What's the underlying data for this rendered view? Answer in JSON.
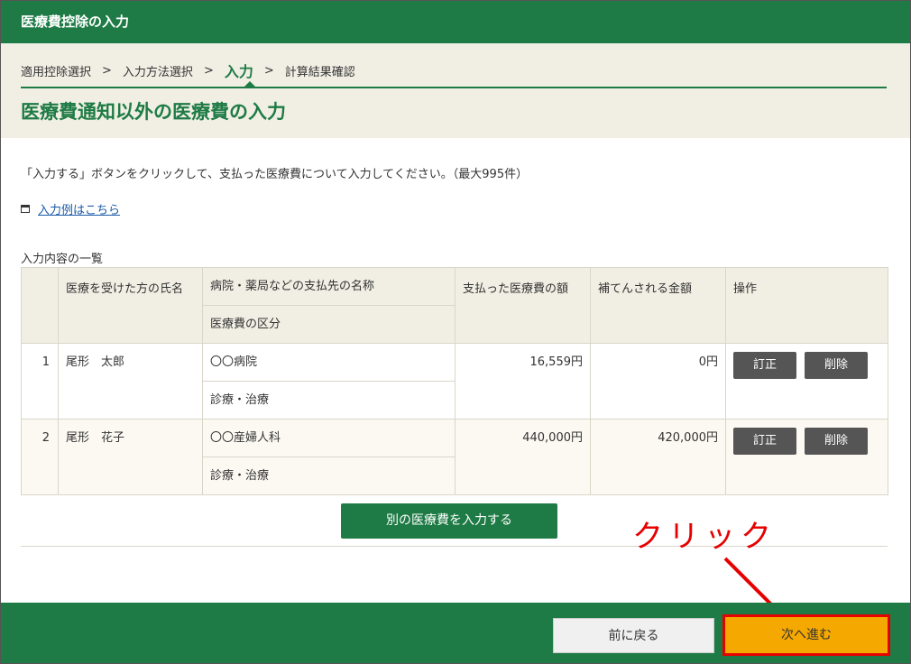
{
  "window": {
    "title": "医療費控除の入力"
  },
  "breadcrumb": {
    "items": [
      {
        "label": "適用控除選択"
      },
      {
        "label": "入力方法選択"
      },
      {
        "label": "入力"
      },
      {
        "label": "計算結果確認"
      }
    ],
    "separator": ">"
  },
  "page": {
    "title": "医療費通知以外の医療費の入力",
    "instruction": "「入力する」ボタンをクリックして、支払った医療費について入力してください。（最大995件）",
    "example_link": "入力例はこちら",
    "list_label": "入力内容の一覧"
  },
  "table": {
    "headers": {
      "name": "医療を受けた方の氏名",
      "payee": "病院・薬局などの支払先の名称",
      "category": "医療費の区分",
      "paid": "支払った医療費の額",
      "reimbursed": "補てんされる金額",
      "ops": "操作"
    },
    "rows": [
      {
        "no": "1",
        "name": "尾形　太郎",
        "payee": "〇〇病院",
        "category": "診療・治療",
        "paid": "16,559円",
        "reimbursed": "0円",
        "edit": "訂正",
        "delete": "削除"
      },
      {
        "no": "2",
        "name": "尾形　花子",
        "payee": "〇〇産婦人科",
        "category": "診療・治療",
        "paid": "440,000円",
        "reimbursed": "420,000円",
        "edit": "訂正",
        "delete": "削除"
      }
    ]
  },
  "actions": {
    "add": "別の医療費を入力する",
    "back": "前に戻る",
    "next": "次へ進む"
  },
  "annotation": {
    "text": "クリック"
  },
  "colors": {
    "brand": "#1e7b45",
    "next_button": "#f5a800",
    "highlight": "#e60000"
  }
}
